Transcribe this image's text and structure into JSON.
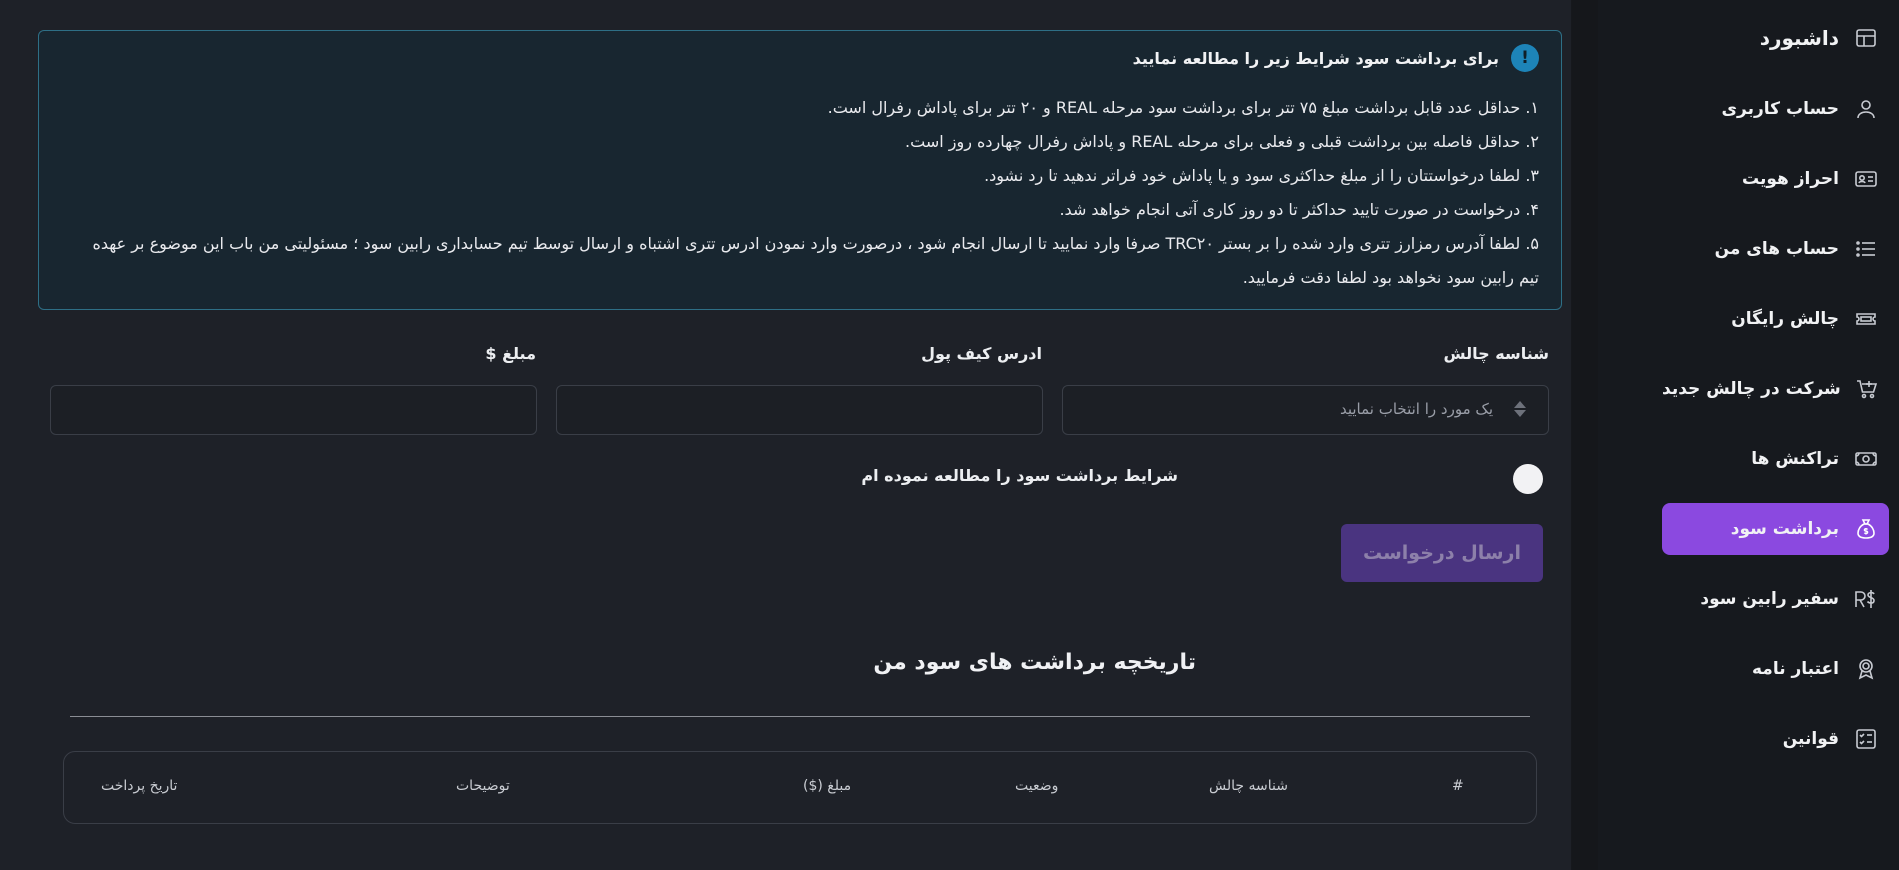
{
  "sidebar": {
    "items": [
      {
        "label": "داشبورد",
        "icon": "dashboard-icon"
      },
      {
        "label": "حساب کاربری",
        "icon": "user-icon"
      },
      {
        "label": "احراز هویت",
        "icon": "id-card-icon"
      },
      {
        "label": "حساب های من",
        "icon": "list-icon"
      },
      {
        "label": "چالش رایگان",
        "icon": "ticket-icon"
      },
      {
        "label": "شرکت در چالش جدید",
        "icon": "cart-plus-icon"
      },
      {
        "label": "تراکنش ها",
        "icon": "money-icon"
      },
      {
        "label": "برداشت سود",
        "icon": "money-bag-icon"
      },
      {
        "label": "سفیر رابین سود",
        "icon": "currency-icon"
      },
      {
        "label": "اعتبار نامه",
        "icon": "certificate-icon"
      },
      {
        "label": "قوانین",
        "icon": "rules-icon"
      }
    ],
    "active_index": 7
  },
  "notice": {
    "icon": "info-icon",
    "icon_glyph": "!",
    "title": "برای برداشت سود شرایط زیر را مطالعه نمایید",
    "lines": [
      "۱. حداقل عدد قابل برداشت مبلغ ۷۵ تتر برای برداشت سود مرحله REAL و ۲۰ تتر برای پاداش رفرال است.",
      "۲. حداقل فاصله بین برداشت قبلی و فعلی برای مرحله REAL و پاداش رفرال چهارده روز است.",
      "۳. لطفا درخواستتان را از مبلغ حداکثری سود و یا پاداش خود فراتر ندهید تا رد نشود.",
      "۴. درخواست در صورت تایید حداکثر تا دو روز کاری آتی انجام خواهد شد.",
      "۵. لطفا آدرس رمزارز تتری وارد شده را بر بستر TRC۲۰ صرفا وارد نمایید تا ارسال انجام شود ، درصورت وارد نمودن ادرس تتری اشتباه و ارسال توسط تیم حسابداری رابین سود ؛ مسئولیتی من باب این موضوع بر عهده",
      "تیم رابین سود نخواهد بود لطفا دقت فرمایید."
    ]
  },
  "form": {
    "challenge_label": "شناسه چالش",
    "challenge_placeholder": "یک مورد را انتخاب نمایید",
    "wallet_label": "ادرس کیف پول",
    "wallet_value": "",
    "amount_label": "مبلغ $",
    "amount_value": "",
    "terms_label": "شرایط برداشت سود را مطالعه نموده ام",
    "submit_label": "ارسال درخواست"
  },
  "history": {
    "title": "تاریخچه برداشت های سود من",
    "columns": [
      "#",
      "شناسه چالش",
      "وضعیت",
      "مبلغ ($)",
      "توضیحات",
      "تاریخ پرداخت"
    ]
  },
  "colors": {
    "accent": "#8b49e0",
    "notice_border": "#2e6f86",
    "notice_bg": "#182630",
    "submit_bg": "#4a3480"
  }
}
